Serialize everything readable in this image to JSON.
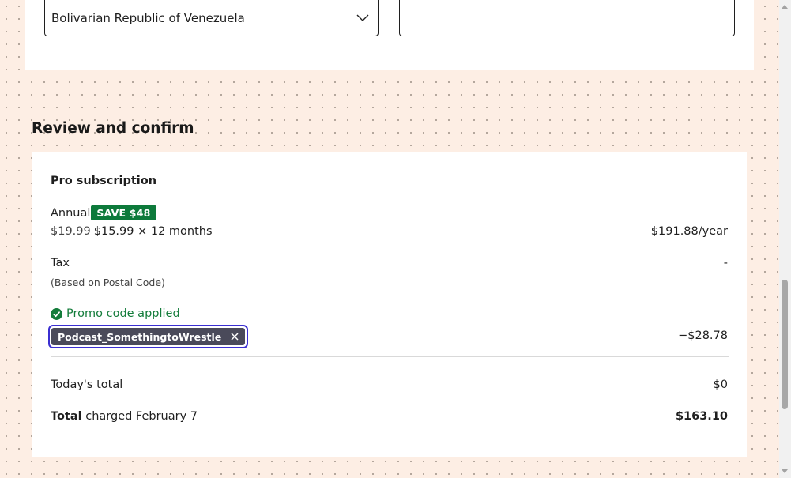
{
  "address": {
    "country_value": "Bolivarian Republic of Venezuela",
    "postal_value": ""
  },
  "review": {
    "title": "Review and confirm",
    "plan_name": "Pro subscription",
    "billing_period": "Annual",
    "save_badge": "SAVE $48",
    "original_price": "$19.99",
    "price_detail": "$15.99 × 12 months",
    "yearly_amount": "$191.88/year",
    "tax_label": "Tax",
    "tax_note": "(Based on Postal Code)",
    "tax_amount": "-",
    "promo_status": "Promo code applied",
    "promo_code": "Podcast_SomethingtoWrestle",
    "promo_discount": "−$28.78",
    "today_label": "Today's total",
    "today_amount": "$0",
    "total_bold": "Total",
    "total_suffix": " charged February 7",
    "total_amount": "$163.10"
  },
  "icons": {
    "chevron": "chevron-down-icon",
    "check": "check-circle-icon",
    "remove": "close-icon"
  },
  "colors": {
    "page_bg": "#fdeee4",
    "save_badge_bg": "#0d7a3b",
    "promo_green": "#137c3a",
    "chip_bg": "#4a4a5a",
    "focus_ring": "#3b2fd1"
  }
}
